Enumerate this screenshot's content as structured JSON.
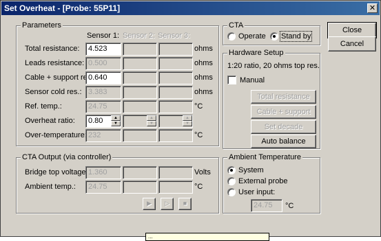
{
  "window": {
    "title": "Set Overheat - [Probe: 55P11]"
  },
  "parameters": {
    "title": "Parameters",
    "columns": [
      "Sensor 1:",
      "Sensor 2:",
      "Sensor 3:"
    ],
    "rows": [
      {
        "label": "Total resistance:",
        "s1": "4.523",
        "unit": "ohms"
      },
      {
        "label": "Leads resistance:",
        "s1": "0.500",
        "unit": "ohms"
      },
      {
        "label": "Cable + support res.:",
        "s1": "0.640",
        "unit": "ohms"
      },
      {
        "label": "Sensor cold res.:",
        "s1": "3.383",
        "unit": "ohms"
      },
      {
        "label": "Ref. temp.:",
        "s1": "24.75",
        "unit": "°C"
      },
      {
        "label": "Overheat ratio:",
        "s1": "0.80",
        "unit": ""
      },
      {
        "label": "Over-temperature:",
        "s1": "232",
        "unit": "°C"
      }
    ]
  },
  "cta_output": {
    "title": "CTA Output (via controller)",
    "rows": [
      {
        "label": "Bridge top voltages:",
        "s1": "1.360",
        "unit": "Volts"
      },
      {
        "label": "Ambient temp.:",
        "s1": "24.75",
        "unit": "°C"
      }
    ],
    "nav": [
      "▶",
      "▷",
      "■"
    ]
  },
  "cta": {
    "title": "CTA",
    "options": [
      "Operate",
      "Stand by"
    ],
    "selected": "Stand by"
  },
  "hardware": {
    "title": "Hardware Setup",
    "info": "1:20 ratio, 20 ohms top res.",
    "manual_label": "Manual",
    "buttons": [
      "Total resistance",
      "Cable + support",
      "Set decade",
      "Auto balance"
    ]
  },
  "ambient": {
    "title": "Ambient Temperature",
    "options": [
      "System",
      "External probe",
      "User input:"
    ],
    "selected": "System",
    "user_value": "24.75",
    "unit": "°C"
  },
  "buttons": {
    "close": "Close",
    "cancel": "Cancel"
  },
  "tooltip": "...",
  "icons": {
    "window_close": "close-icon"
  }
}
